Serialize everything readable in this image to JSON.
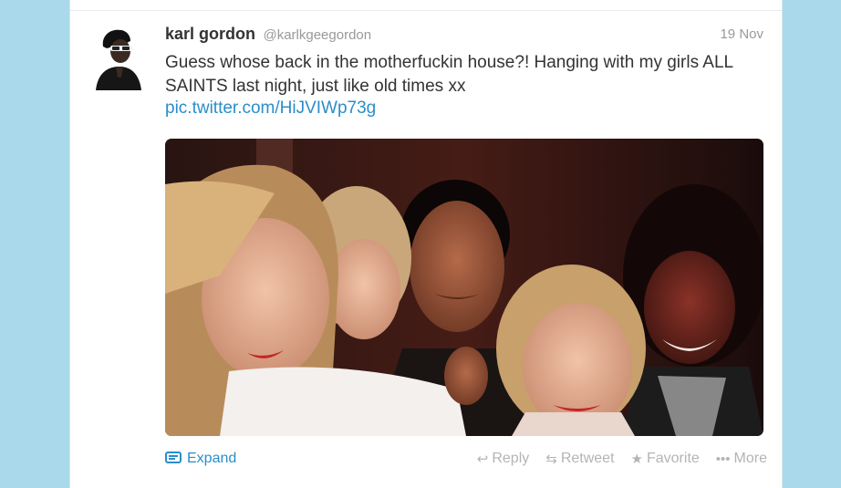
{
  "tweet": {
    "name": "karl gordon",
    "handle": "@karlkgeegordon",
    "date": "19 Nov",
    "text": "Guess whose back in the motherfuckin house?! Hanging with my girls ALL SAINTS last night, just like old times xx",
    "link": "pic.twitter.com/HiJVIWp73g"
  },
  "actions": {
    "expand": "Expand",
    "reply": "Reply",
    "retweet": "Retweet",
    "favorite": "Favorite",
    "more": "More"
  },
  "icons": {
    "expand": "photo-icon",
    "reply": "reply-arrow-icon",
    "retweet": "retweet-icon",
    "favorite": "star-icon",
    "more": "dots-icon"
  },
  "colors": {
    "background": "#a9d9ea",
    "link": "#2a8ec9",
    "muted": "#b4b4b4"
  }
}
